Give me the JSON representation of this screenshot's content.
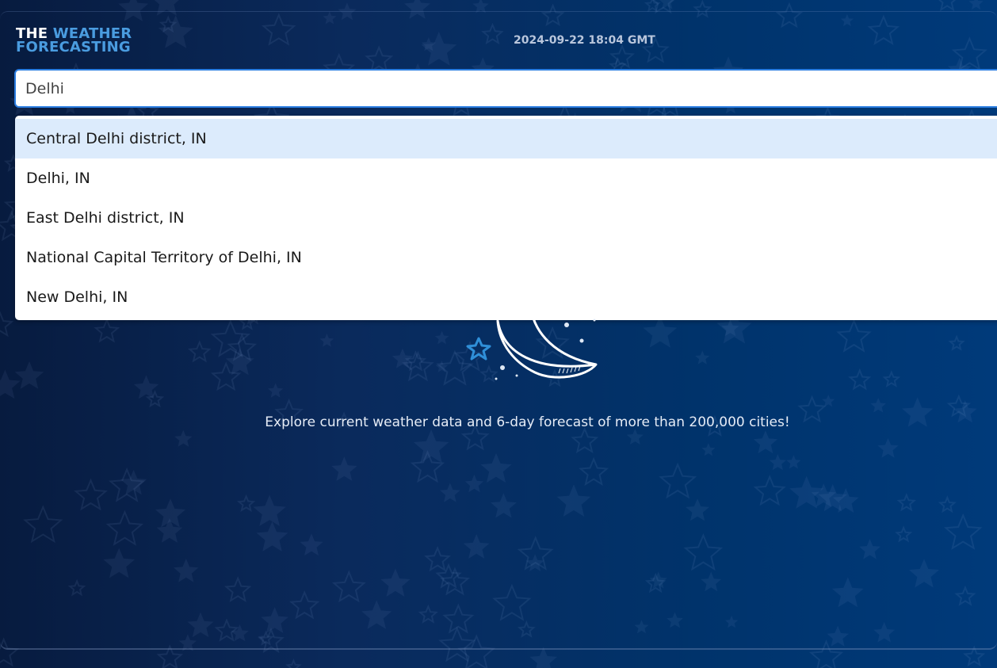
{
  "app": {
    "logo_line1_a": "THE ",
    "logo_line1_b": "WEATHER",
    "logo_line2_a": "F",
    "logo_line2_b": "ORECASTING",
    "datetime": "2024-09-22 18:04 GMT"
  },
  "search": {
    "value": "Delhi"
  },
  "suggestions": [
    "Central Delhi district, IN",
    "Delhi, IN",
    "East Delhi district, IN",
    "National Capital Territory of Delhi, IN",
    "New Delhi, IN"
  ],
  "main": {
    "tagline": "Explore current weather data and 6-day forecast of more than 200,000 cities!",
    "illustration_icon": "moon-and-stars-icon"
  },
  "colors": {
    "accent": "#2a7de1",
    "logo_accent": "#4a9ce0",
    "highlight": "#dcebfc",
    "background_dark": "#071b3f",
    "background_light": "#003a7a"
  }
}
